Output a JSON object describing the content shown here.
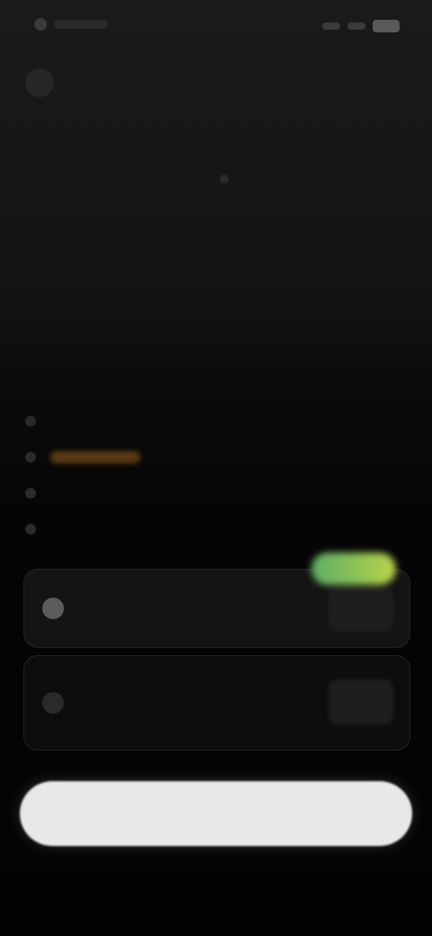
{
  "status_bar": {
    "icons": [
      "notification-dot-icon",
      "signal-icon",
      "wifi-icon",
      "battery-icon"
    ]
  },
  "header": {
    "back_icon": "back-arrow-icon"
  },
  "panel": {
    "title": "",
    "features": [
      {
        "icon": "check-icon",
        "text": ""
      },
      {
        "icon": "check-icon",
        "text": ""
      },
      {
        "icon": "check-icon",
        "text": ""
      },
      {
        "icon": "check-icon",
        "text": ""
      }
    ]
  },
  "plans": {
    "badge": "",
    "monthly": {
      "label": "",
      "price": ""
    },
    "annual": {
      "label": "",
      "price": ""
    }
  },
  "cta": {
    "label": ""
  },
  "colors": {
    "background": "#050505",
    "badge_start": "#5fae66",
    "badge_end": "#b7d34a",
    "highlight": "#5a3a12",
    "cta": "#e8e8e8"
  }
}
